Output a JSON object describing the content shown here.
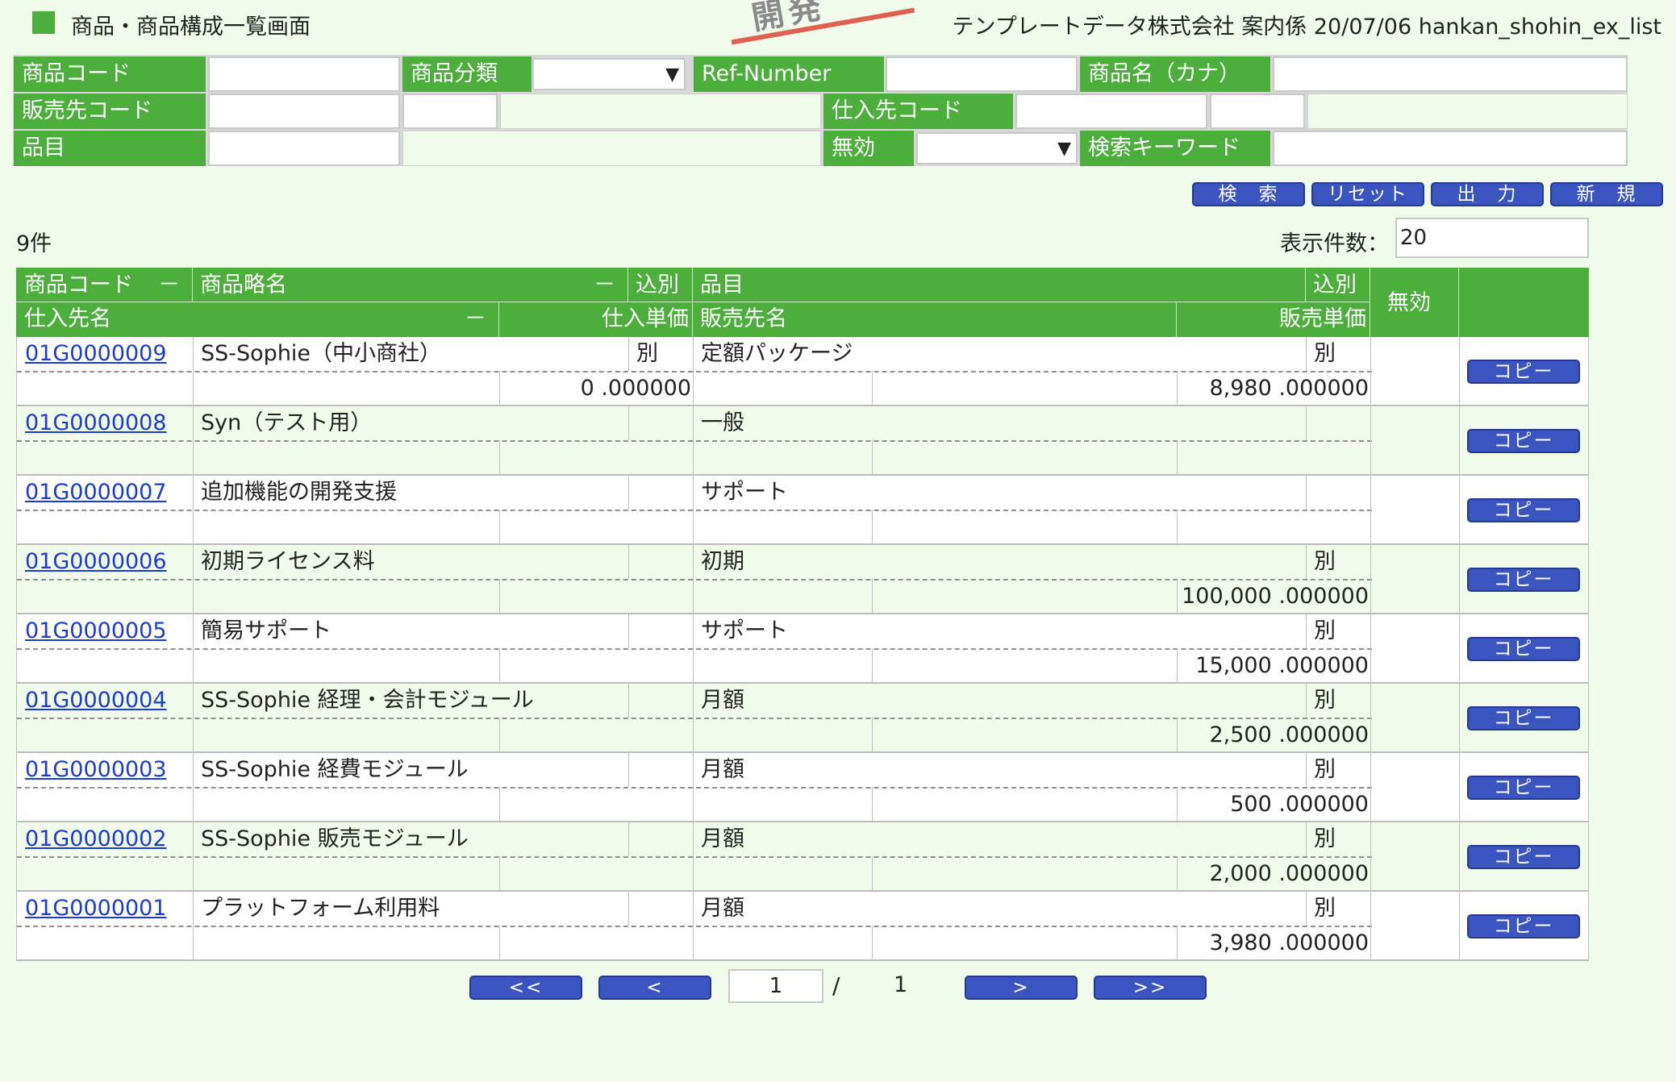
{
  "header": {
    "title": "商品・商品構成一覧画面",
    "stamp": "開発",
    "company": "テンプレートデータ株式会社 案内係 20/07/06 hankan_shohin_ex_list"
  },
  "search": {
    "labels": {
      "product_code": "商品コード",
      "category": "商品分類",
      "ref_number": "Ref-Number",
      "product_kana": "商品名（カナ）",
      "customer_code": "販売先コード",
      "supplier_code": "仕入先コード",
      "item": "品目",
      "invalid": "無効",
      "keyword": "検索キーワード"
    }
  },
  "buttons": {
    "search": "検　索",
    "reset": "リセット",
    "output": "出　力",
    "new": "新　規",
    "copy": "コピー"
  },
  "list": {
    "count": "9件",
    "per_page_label": "表示件数：",
    "per_page": "20"
  },
  "table": {
    "headers": {
      "code": "商品コード",
      "sort": "－",
      "short_name": "商品略名",
      "tax": "込別",
      "item": "品目",
      "invalid": "無効",
      "supplier": "仕入先名",
      "purchase_price": "仕入単価",
      "customer": "販売先名",
      "sale_price": "販売単価"
    },
    "rows": [
      {
        "code": "01G0000009",
        "name": "SS-Sophie（中小商社）",
        "tax1": "別",
        "item": "定額パッケージ",
        "tax2": "別",
        "purchase": "0 .000000",
        "sale": "8,980 .000000"
      },
      {
        "code": "01G0000008",
        "name": "Syn（テスト用）",
        "tax1": "",
        "item": "一般",
        "tax2": "",
        "purchase": "",
        "sale": ""
      },
      {
        "code": "01G0000007",
        "name": "追加機能の開発支援",
        "tax1": "",
        "item": "サポート",
        "tax2": "",
        "purchase": "",
        "sale": ""
      },
      {
        "code": "01G0000006",
        "name": "初期ライセンス料",
        "tax1": "",
        "item": "初期",
        "tax2": "別",
        "purchase": "",
        "sale": "100,000 .000000"
      },
      {
        "code": "01G0000005",
        "name": "簡易サポート",
        "tax1": "",
        "item": "サポート",
        "tax2": "別",
        "purchase": "",
        "sale": "15,000 .000000"
      },
      {
        "code": "01G0000004",
        "name": "SS-Sophie 経理・会計モジュール",
        "tax1": "",
        "item": "月額",
        "tax2": "別",
        "purchase": "",
        "sale": "2,500 .000000"
      },
      {
        "code": "01G0000003",
        "name": "SS-Sophie 経費モジュール",
        "tax1": "",
        "item": "月額",
        "tax2": "別",
        "purchase": "",
        "sale": "500 .000000"
      },
      {
        "code": "01G0000002",
        "name": "SS-Sophie 販売モジュール",
        "tax1": "",
        "item": "月額",
        "tax2": "別",
        "purchase": "",
        "sale": "2,000 .000000"
      },
      {
        "code": "01G0000001",
        "name": "プラットフォーム利用料",
        "tax1": "",
        "item": "月額",
        "tax2": "別",
        "purchase": "",
        "sale": "3,980 .000000"
      }
    ]
  },
  "pager": {
    "first": "<<",
    "prev": "<",
    "current": "1",
    "slash": "/",
    "total": "1",
    "next": ">",
    "last": ">>"
  }
}
